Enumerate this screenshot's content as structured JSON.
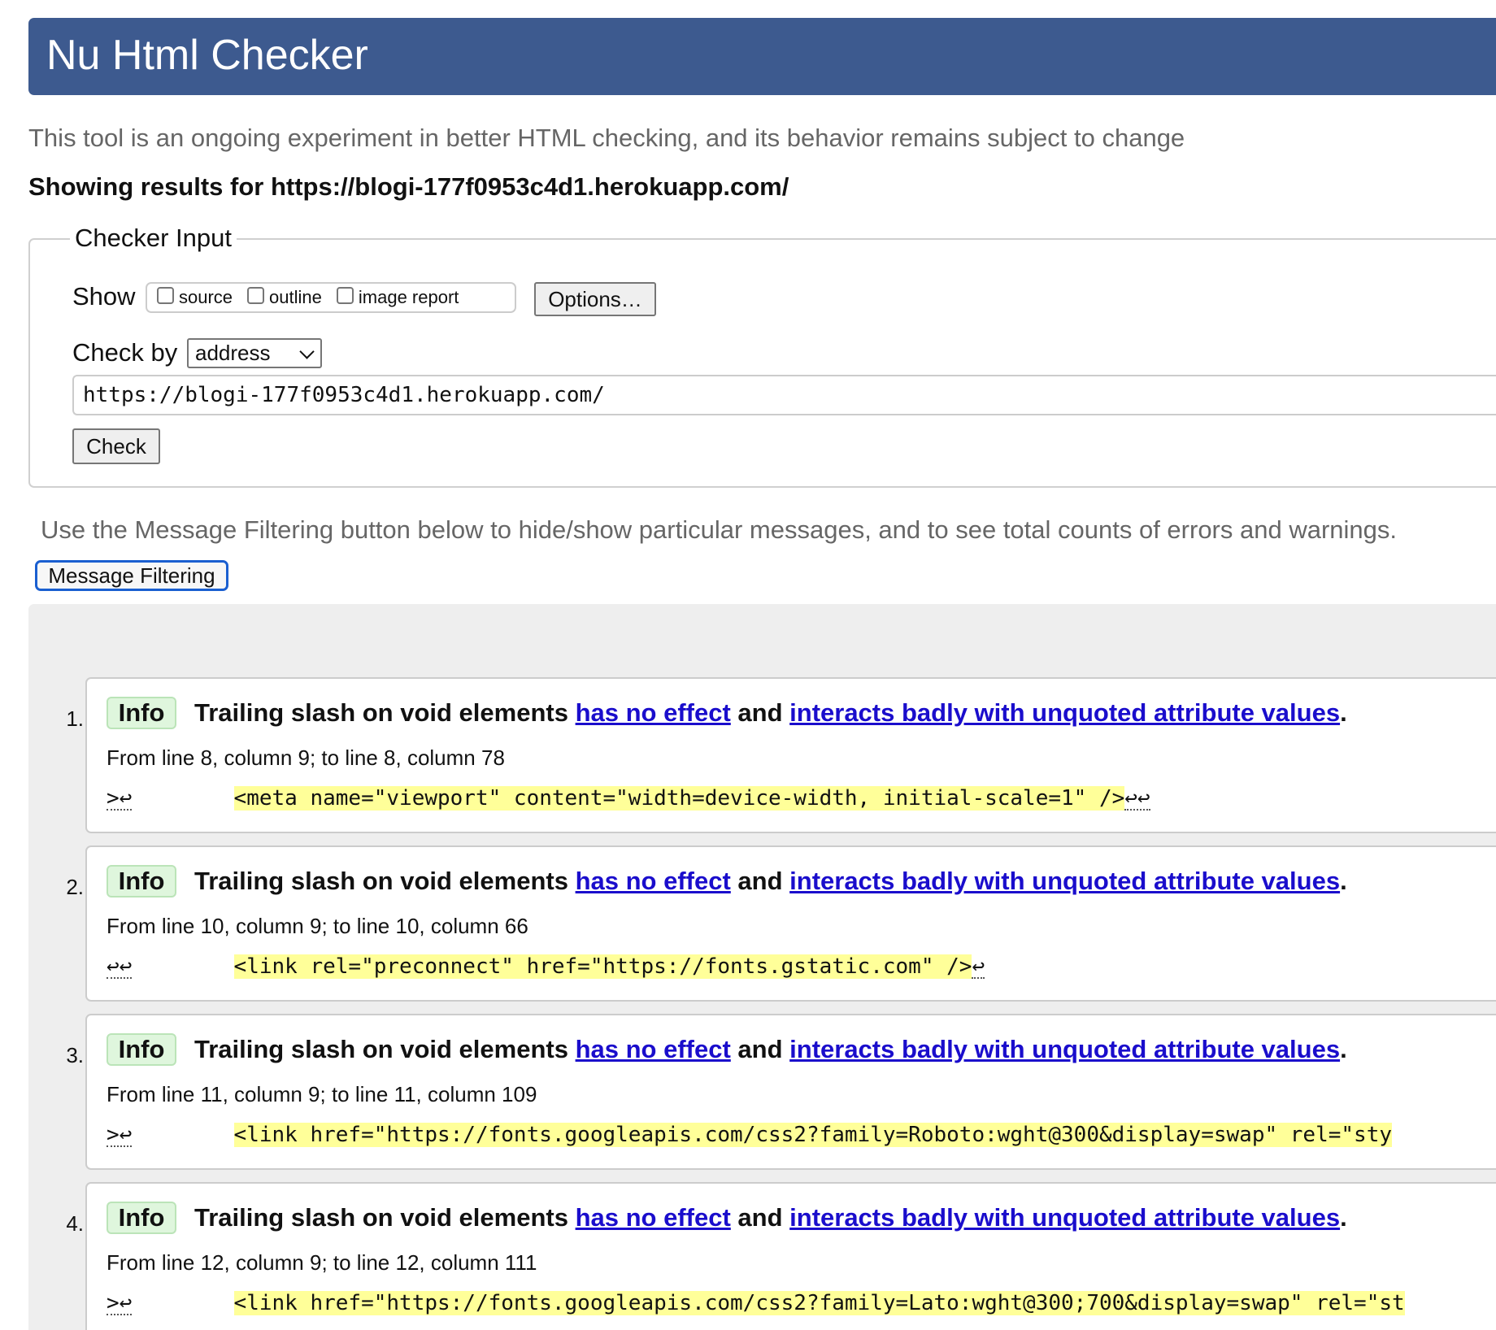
{
  "header": {
    "title": "Nu Html Checker"
  },
  "subtitle": "This tool is an ongoing experiment in better HTML checking, and its behavior remains subject to change",
  "showing": "Showing results for https://blogi-177f0953c4d1.herokuapp.com/",
  "checker_input": {
    "legend": "Checker Input",
    "show_label": "Show",
    "show_options": [
      {
        "label": "source",
        "checked": false
      },
      {
        "label": "outline",
        "checked": false
      },
      {
        "label": "image report",
        "checked": false
      }
    ],
    "options_button": "Options…",
    "check_by_label": "Check by",
    "check_by_value": "address",
    "url_value": "https://blogi-177f0953c4d1.herokuapp.com/",
    "check_button": "Check"
  },
  "filter_note": "Use the Message Filtering button below to hide/show particular messages, and to see total counts of errors and warnings.",
  "filter_button": "Message Filtering",
  "messages": [
    {
      "number": "1.",
      "type": "Info",
      "title_pre": "Trailing slash on void elements ",
      "link1": "has no effect",
      "title_mid": " and ",
      "link2": "interacts badly with unquoted attribute values",
      "title_post": ".",
      "location": "From line 8, column 9; to line 8, column 78",
      "extract_pre": ">↩",
      "extract_code": "<meta name=\"viewport\" content=\"width=device-width, initial-scale=1\" />",
      "extract_post": "↩↩"
    },
    {
      "number": "2.",
      "type": "Info",
      "title_pre": "Trailing slash on void elements ",
      "link1": "has no effect",
      "title_mid": " and ",
      "link2": "interacts badly with unquoted attribute values",
      "title_post": ".",
      "location": "From line 10, column 9; to line 10, column 66",
      "extract_pre": "↩↩",
      "extract_code": "<link rel=\"preconnect\" href=\"https://fonts.gstatic.com\" />",
      "extract_post": "↩"
    },
    {
      "number": "3.",
      "type": "Info",
      "title_pre": "Trailing slash on void elements ",
      "link1": "has no effect",
      "title_mid": " and ",
      "link2": "interacts badly with unquoted attribute values",
      "title_post": ".",
      "location": "From line 11, column 9; to line 11, column 109",
      "extract_pre": ">↩",
      "extract_code": "<link href=\"https://fonts.googleapis.com/css2?family=Roboto:wght@300&display=swap\" rel=\"sty",
      "extract_post": ""
    },
    {
      "number": "4.",
      "type": "Info",
      "title_pre": "Trailing slash on void elements ",
      "link1": "has no effect",
      "title_mid": " and ",
      "link2": "interacts badly with unquoted attribute values",
      "title_post": ".",
      "location": "From line 12, column 9; to line 12, column 111",
      "extract_pre": ">↩",
      "extract_code": "<link href=\"https://fonts.googleapis.com/css2?family=Lato:wght@300;700&display=swap\" rel=\"st",
      "extract_post": ""
    }
  ],
  "colors": {
    "header_bg": "#3d5a8f",
    "info_badge_bg": "#dff6dd",
    "highlight": "#ffff99",
    "link": "#1a0dcc"
  }
}
